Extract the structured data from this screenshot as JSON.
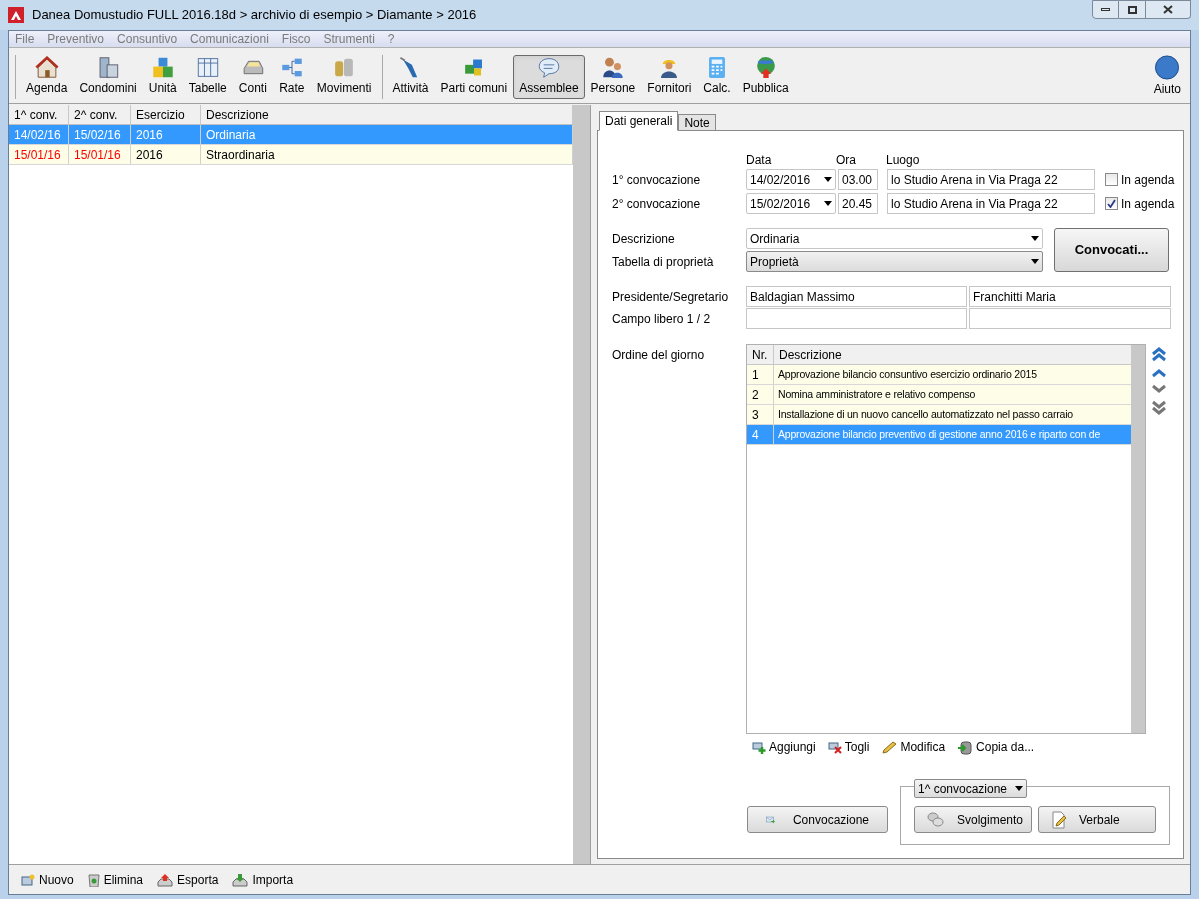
{
  "window": {
    "title": "Danea Domustudio FULL 2016.18d > archivio di esempio > Diamante > 2016"
  },
  "menu": [
    "File",
    "Preventivo",
    "Consuntivo",
    "Comunicazioni",
    "Fisco",
    "Strumenti",
    "?"
  ],
  "toolbar": [
    {
      "label": "Agenda",
      "selected": false
    },
    {
      "label": "Condomini",
      "selected": false
    },
    {
      "label": "Unità",
      "selected": false
    },
    {
      "label": "Tabelle",
      "selected": false
    },
    {
      "label": "Conti",
      "selected": false
    },
    {
      "label": "Rate",
      "selected": false
    },
    {
      "label": "Movimenti",
      "selected": false
    },
    {
      "label": "Attività",
      "selected": false
    },
    {
      "label": "Parti comuni",
      "selected": false
    },
    {
      "label": "Assemblee",
      "selected": true
    },
    {
      "label": "Persone",
      "selected": false
    },
    {
      "label": "Fornitori",
      "selected": false
    },
    {
      "label": "Calc.",
      "selected": false
    },
    {
      "label": "Pubblica",
      "selected": false
    }
  ],
  "help_button": "Aiuto",
  "list": {
    "columns": [
      "1^ conv.",
      "2^ conv.",
      "Esercizio",
      "Descrizione"
    ],
    "rows": [
      {
        "cells": [
          "14/02/16",
          "15/02/16",
          "2016",
          "Ordinaria"
        ],
        "selected": true,
        "expired": false
      },
      {
        "cells": [
          "15/01/16",
          "15/01/16",
          "2016",
          "Straordinaria"
        ],
        "selected": false,
        "expired": true
      }
    ]
  },
  "tabs": [
    {
      "label": "Dati generali",
      "selected": true
    },
    {
      "label": "Note",
      "selected": false
    }
  ],
  "form": {
    "headers": [
      "Data",
      "Ora",
      "Luogo"
    ],
    "convocations": [
      {
        "label": "1° convocazione",
        "date": "14/02/2016",
        "time": "03.00",
        "place": "lo Studio Arena in Via Praga 22",
        "in_agenda_label": "In agenda",
        "in_agenda": false
      },
      {
        "label": "2° convocazione",
        "date": "15/02/2016",
        "time": "20.45",
        "place": "lo Studio Arena in Via Praga 22",
        "in_agenda_label": "In agenda",
        "in_agenda": true
      }
    ],
    "description_label": "Descrizione",
    "description": "Ordinaria",
    "table_label": "Tabella di proprietà",
    "table": "Proprietà",
    "invitees_button": "Convocati...",
    "president_label": "Presidente/Segretario",
    "president": "Baldagian Massimo",
    "secretary": "Franchitti Maria",
    "free_label": "Campo libero 1 / 2",
    "agenda_label": "Ordine del giorno"
  },
  "agenda": {
    "columns": [
      "Nr.",
      "Descrizione"
    ],
    "rows": [
      {
        "nr": "1",
        "text": "Approvazione bilancio consuntivo esercizio ordinario 2015",
        "selected": false
      },
      {
        "nr": "2",
        "text": "Nomina amministratore e relativo compenso",
        "selected": false
      },
      {
        "nr": "3",
        "text": "Installazione di un nuovo cancello automatizzato nel passo carraio",
        "selected": false
      },
      {
        "nr": "4",
        "text": "Approvazione bilancio preventivo di gestione anno 2016 e riparto con de",
        "selected": true
      }
    ]
  },
  "agenda_actions": [
    "Aggiungi",
    "Togli",
    "Modifica",
    "Copia da..."
  ],
  "convocation_button": "Convocazione",
  "session_select": "1^ convocazione",
  "session_buttons": [
    "Svolgimento",
    "Verbale"
  ],
  "status_actions": [
    "Nuovo",
    "Elimina",
    "Esporta",
    "Importa"
  ]
}
